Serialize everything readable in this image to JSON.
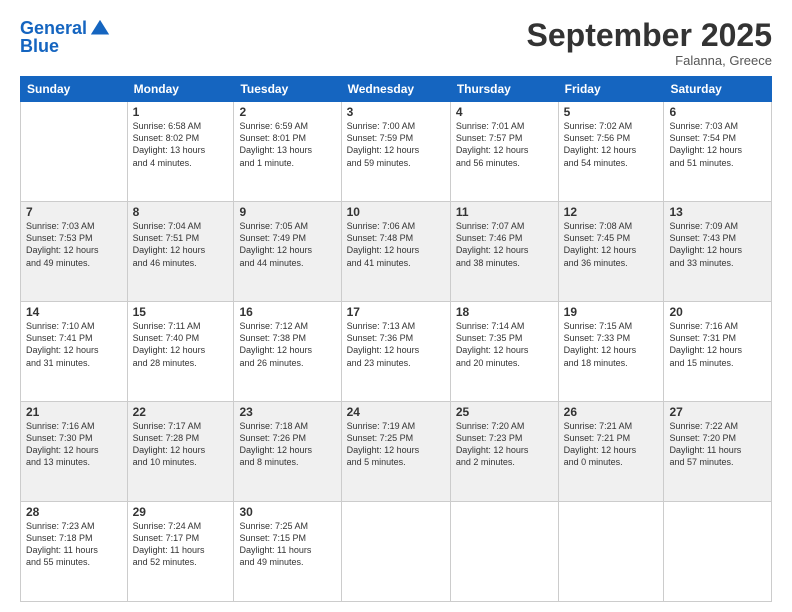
{
  "header": {
    "logo_line1": "General",
    "logo_line2": "Blue",
    "month": "September 2025",
    "location": "Falanna, Greece"
  },
  "weekdays": [
    "Sunday",
    "Monday",
    "Tuesday",
    "Wednesday",
    "Thursday",
    "Friday",
    "Saturday"
  ],
  "weeks": [
    [
      {
        "day": "",
        "info": ""
      },
      {
        "day": "1",
        "info": "Sunrise: 6:58 AM\nSunset: 8:02 PM\nDaylight: 13 hours\nand 4 minutes."
      },
      {
        "day": "2",
        "info": "Sunrise: 6:59 AM\nSunset: 8:01 PM\nDaylight: 13 hours\nand 1 minute."
      },
      {
        "day": "3",
        "info": "Sunrise: 7:00 AM\nSunset: 7:59 PM\nDaylight: 12 hours\nand 59 minutes."
      },
      {
        "day": "4",
        "info": "Sunrise: 7:01 AM\nSunset: 7:57 PM\nDaylight: 12 hours\nand 56 minutes."
      },
      {
        "day": "5",
        "info": "Sunrise: 7:02 AM\nSunset: 7:56 PM\nDaylight: 12 hours\nand 54 minutes."
      },
      {
        "day": "6",
        "info": "Sunrise: 7:03 AM\nSunset: 7:54 PM\nDaylight: 12 hours\nand 51 minutes."
      }
    ],
    [
      {
        "day": "7",
        "info": "Sunrise: 7:03 AM\nSunset: 7:53 PM\nDaylight: 12 hours\nand 49 minutes."
      },
      {
        "day": "8",
        "info": "Sunrise: 7:04 AM\nSunset: 7:51 PM\nDaylight: 12 hours\nand 46 minutes."
      },
      {
        "day": "9",
        "info": "Sunrise: 7:05 AM\nSunset: 7:49 PM\nDaylight: 12 hours\nand 44 minutes."
      },
      {
        "day": "10",
        "info": "Sunrise: 7:06 AM\nSunset: 7:48 PM\nDaylight: 12 hours\nand 41 minutes."
      },
      {
        "day": "11",
        "info": "Sunrise: 7:07 AM\nSunset: 7:46 PM\nDaylight: 12 hours\nand 38 minutes."
      },
      {
        "day": "12",
        "info": "Sunrise: 7:08 AM\nSunset: 7:45 PM\nDaylight: 12 hours\nand 36 minutes."
      },
      {
        "day": "13",
        "info": "Sunrise: 7:09 AM\nSunset: 7:43 PM\nDaylight: 12 hours\nand 33 minutes."
      }
    ],
    [
      {
        "day": "14",
        "info": "Sunrise: 7:10 AM\nSunset: 7:41 PM\nDaylight: 12 hours\nand 31 minutes."
      },
      {
        "day": "15",
        "info": "Sunrise: 7:11 AM\nSunset: 7:40 PM\nDaylight: 12 hours\nand 28 minutes."
      },
      {
        "day": "16",
        "info": "Sunrise: 7:12 AM\nSunset: 7:38 PM\nDaylight: 12 hours\nand 26 minutes."
      },
      {
        "day": "17",
        "info": "Sunrise: 7:13 AM\nSunset: 7:36 PM\nDaylight: 12 hours\nand 23 minutes."
      },
      {
        "day": "18",
        "info": "Sunrise: 7:14 AM\nSunset: 7:35 PM\nDaylight: 12 hours\nand 20 minutes."
      },
      {
        "day": "19",
        "info": "Sunrise: 7:15 AM\nSunset: 7:33 PM\nDaylight: 12 hours\nand 18 minutes."
      },
      {
        "day": "20",
        "info": "Sunrise: 7:16 AM\nSunset: 7:31 PM\nDaylight: 12 hours\nand 15 minutes."
      }
    ],
    [
      {
        "day": "21",
        "info": "Sunrise: 7:16 AM\nSunset: 7:30 PM\nDaylight: 12 hours\nand 13 minutes."
      },
      {
        "day": "22",
        "info": "Sunrise: 7:17 AM\nSunset: 7:28 PM\nDaylight: 12 hours\nand 10 minutes."
      },
      {
        "day": "23",
        "info": "Sunrise: 7:18 AM\nSunset: 7:26 PM\nDaylight: 12 hours\nand 8 minutes."
      },
      {
        "day": "24",
        "info": "Sunrise: 7:19 AM\nSunset: 7:25 PM\nDaylight: 12 hours\nand 5 minutes."
      },
      {
        "day": "25",
        "info": "Sunrise: 7:20 AM\nSunset: 7:23 PM\nDaylight: 12 hours\nand 2 minutes."
      },
      {
        "day": "26",
        "info": "Sunrise: 7:21 AM\nSunset: 7:21 PM\nDaylight: 12 hours\nand 0 minutes."
      },
      {
        "day": "27",
        "info": "Sunrise: 7:22 AM\nSunset: 7:20 PM\nDaylight: 11 hours\nand 57 minutes."
      }
    ],
    [
      {
        "day": "28",
        "info": "Sunrise: 7:23 AM\nSunset: 7:18 PM\nDaylight: 11 hours\nand 55 minutes."
      },
      {
        "day": "29",
        "info": "Sunrise: 7:24 AM\nSunset: 7:17 PM\nDaylight: 11 hours\nand 52 minutes."
      },
      {
        "day": "30",
        "info": "Sunrise: 7:25 AM\nSunset: 7:15 PM\nDaylight: 11 hours\nand 49 minutes."
      },
      {
        "day": "",
        "info": ""
      },
      {
        "day": "",
        "info": ""
      },
      {
        "day": "",
        "info": ""
      },
      {
        "day": "",
        "info": ""
      }
    ]
  ]
}
